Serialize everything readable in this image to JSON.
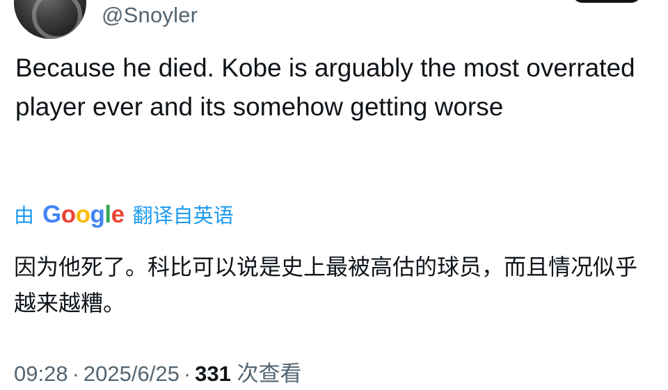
{
  "user": {
    "handle": "@Snoyler"
  },
  "tweet": {
    "text": "Because he died. Kobe is arguably the most overrated player ever and its somehow getting worse"
  },
  "translation": {
    "by_label": "由",
    "google_letters": [
      "G",
      "o",
      "o",
      "g",
      "l",
      "e"
    ],
    "google_colors": [
      "#4285f4",
      "#ea4335",
      "#fbbc05",
      "#4285f4",
      "#34a853",
      "#ea4335"
    ],
    "action_label": "翻译自英语",
    "text": "因为他死了。科比可以说是史上最被高估的球员，而且情况似乎越来越糟。"
  },
  "meta": {
    "time": "09:28",
    "separator": "·",
    "date": "2025/6/25",
    "views_count": "331",
    "views_label": "次查看"
  },
  "colors": {
    "link_blue": "#1d9bf0",
    "secondary_gray": "#536471",
    "text_black": "#0f1419"
  }
}
